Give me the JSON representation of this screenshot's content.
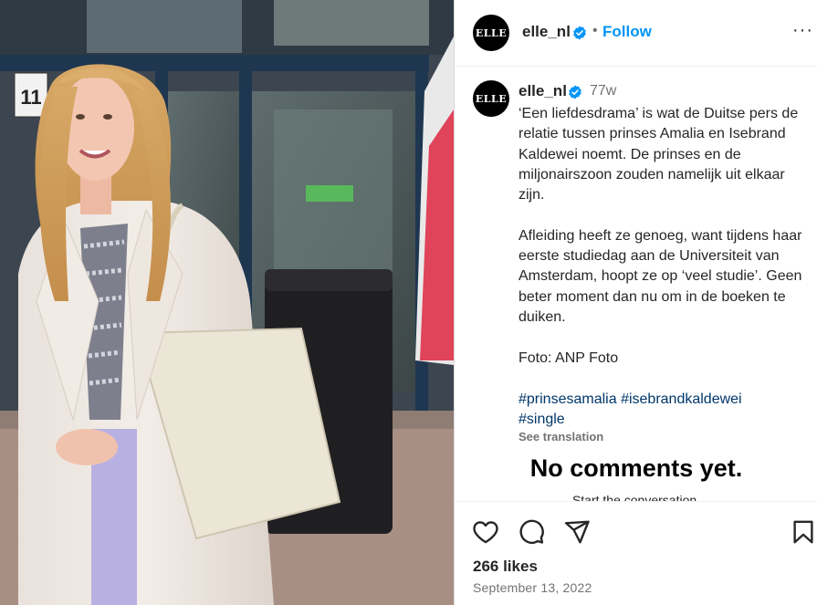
{
  "post": {
    "username": "elle_nl",
    "avatar_text": "ELLE",
    "follow_label": "Follow",
    "separator": "•",
    "more_label": "···",
    "time_ago": "77w",
    "caption": "‘Een liefdesdrama’ is wat de Duitse pers de relatie tussen prinses Amalia en Isebrand Kaldewei noemt. De prinses en de miljonairszoon zouden namelijk uit elkaar zijn.\n\nAfleiding heeft ze genoeg, want tijdens haar eerste studiedag aan de Universiteit van Amsterdam, hoopt ze op ‘veel studie’. Geen beter moment dan nu om in de boeken te duiken.\n\nFoto: ANP Foto",
    "hashtags": [
      "#prinsesamalia",
      "#isebrandkaldewei",
      "#single"
    ],
    "see_translation": "See translation",
    "no_comments": "No comments yet.",
    "start_conversation": "Start the conversation.",
    "likes": "266 likes",
    "date": "September 13, 2022"
  },
  "photo": {
    "door_number": "11"
  },
  "icons": {
    "verified": "verified-badge-icon",
    "like": "heart-icon",
    "comment": "comment-bubble-icon",
    "share": "paper-plane-icon",
    "save": "bookmark-icon"
  },
  "colors": {
    "follow_blue": "#0095f6",
    "hashtag_blue": "#00376b",
    "muted": "#737373"
  }
}
